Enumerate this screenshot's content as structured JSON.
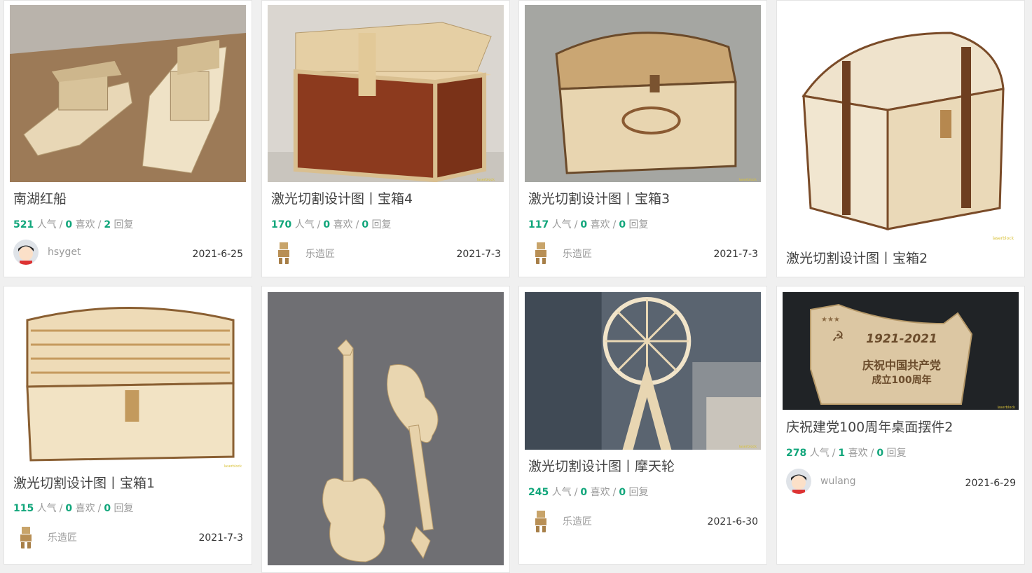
{
  "labels": {
    "pop": "人气",
    "like": "喜欢",
    "reply": "回复",
    "sep": "/"
  },
  "cards": [
    {
      "title": "南湖红船",
      "pop": "521",
      "like": "0",
      "reply": "2",
      "author": "hsyget",
      "date": "2021-6-25"
    },
    {
      "title": "激光切割设计图丨宝箱4",
      "pop": "170",
      "like": "0",
      "reply": "0",
      "author": "乐造匠",
      "date": "2021-7-3"
    },
    {
      "title": "激光切割设计图丨宝箱3",
      "pop": "117",
      "like": "0",
      "reply": "0",
      "author": "乐造匠",
      "date": "2021-7-3"
    },
    {
      "title": "激光切割设计图丨宝箱2"
    },
    {
      "title": "激光切割设计图丨宝箱1",
      "pop": "115",
      "like": "0",
      "reply": "0",
      "author": "乐造匠",
      "date": "2021-7-3"
    },
    {},
    {
      "title": "激光切割设计图丨摩天轮",
      "pop": "245",
      "like": "0",
      "reply": "0",
      "author": "乐造匠",
      "date": "2021-6-30"
    },
    {
      "title": "庆祝建党100周年桌面摆件2",
      "pop": "278",
      "like": "1",
      "reply": "0",
      "author": "wulang",
      "date": "2021-6-29"
    }
  ],
  "image_text": {
    "watermark": "laserblock",
    "plaque_years": "1921-2021",
    "plaque_line1": "庆祝中国共产党",
    "plaque_line2": "成立100周年"
  },
  "colors": {
    "accent": "#12a67b",
    "title": "#444444",
    "muted": "#999999"
  }
}
